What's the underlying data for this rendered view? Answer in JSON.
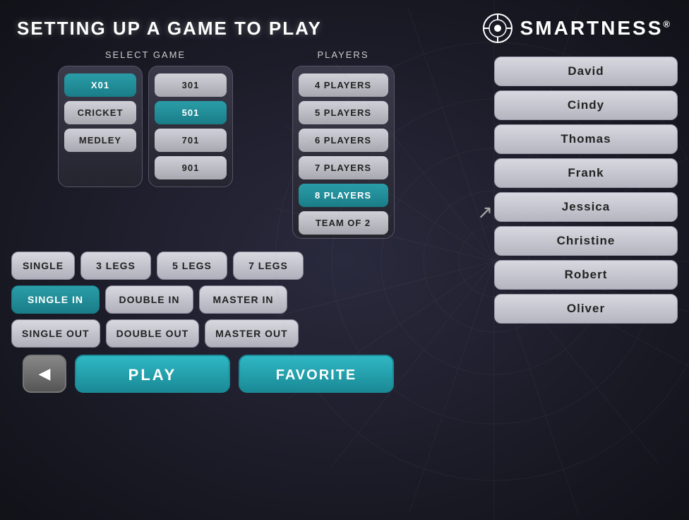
{
  "header": {
    "title": "SETTING UP A GAME TO PLAY",
    "logo_text": "SMARTNESS",
    "logo_reg": "®"
  },
  "select_game": {
    "label": "SELECT GAME",
    "games": [
      {
        "id": "x01",
        "label": "X01",
        "active": false
      },
      {
        "id": "cricket",
        "label": "CRICKET",
        "active": false
      },
      {
        "id": "medley",
        "label": "MEDLEY",
        "active": false
      }
    ],
    "scores": [
      {
        "id": "301",
        "label": "301",
        "active": false
      },
      {
        "id": "501",
        "label": "501",
        "active": true
      },
      {
        "id": "701",
        "label": "701",
        "active": false
      },
      {
        "id": "901",
        "label": "901",
        "active": false
      }
    ]
  },
  "players": {
    "label": "PLAYERS",
    "options": [
      {
        "id": "4players",
        "label": "4 PLAYERS",
        "active": false
      },
      {
        "id": "5players",
        "label": "5 PLAYERS",
        "active": false
      },
      {
        "id": "6players",
        "label": "6 PLAYERS",
        "active": false
      },
      {
        "id": "7players",
        "label": "7 PLAYERS",
        "active": false
      },
      {
        "id": "8players",
        "label": "8 PLAYERS",
        "active": true
      },
      {
        "id": "teamof2",
        "label": "TEAM OF 2",
        "active": false
      }
    ]
  },
  "options": {
    "legs_row": [
      {
        "id": "single",
        "label": "SINGLE",
        "active": false
      },
      {
        "id": "3legs",
        "label": "3 LEGS",
        "active": false
      },
      {
        "id": "5legs",
        "label": "5 LEGS",
        "active": false
      },
      {
        "id": "7legs",
        "label": "7 LEGS",
        "active": false
      }
    ],
    "in_row": [
      {
        "id": "singlein",
        "label": "SINGLE IN",
        "active": true
      },
      {
        "id": "doublein",
        "label": "DOUBLE IN",
        "active": false
      },
      {
        "id": "masterin",
        "label": "MASTER IN",
        "active": false
      }
    ],
    "out_row": [
      {
        "id": "singleout",
        "label": "SINGLE OUT",
        "active": false
      },
      {
        "id": "doubleout",
        "label": "DOUBLE OUT",
        "active": false
      },
      {
        "id": "masterout",
        "label": "MASTER OUT",
        "active": false
      }
    ]
  },
  "actions": {
    "back_label": "◀",
    "play_label": "PLAY",
    "favorite_label": "FAVORITE"
  },
  "player_list": [
    {
      "id": "david",
      "name": "David"
    },
    {
      "id": "cindy",
      "name": "Cindy"
    },
    {
      "id": "thomas",
      "name": "Thomas"
    },
    {
      "id": "frank",
      "name": "Frank"
    },
    {
      "id": "jessica",
      "name": "Jessica"
    },
    {
      "id": "christine",
      "name": "Christine"
    },
    {
      "id": "robert",
      "name": "Robert"
    },
    {
      "id": "oliver",
      "name": "Oliver"
    }
  ]
}
